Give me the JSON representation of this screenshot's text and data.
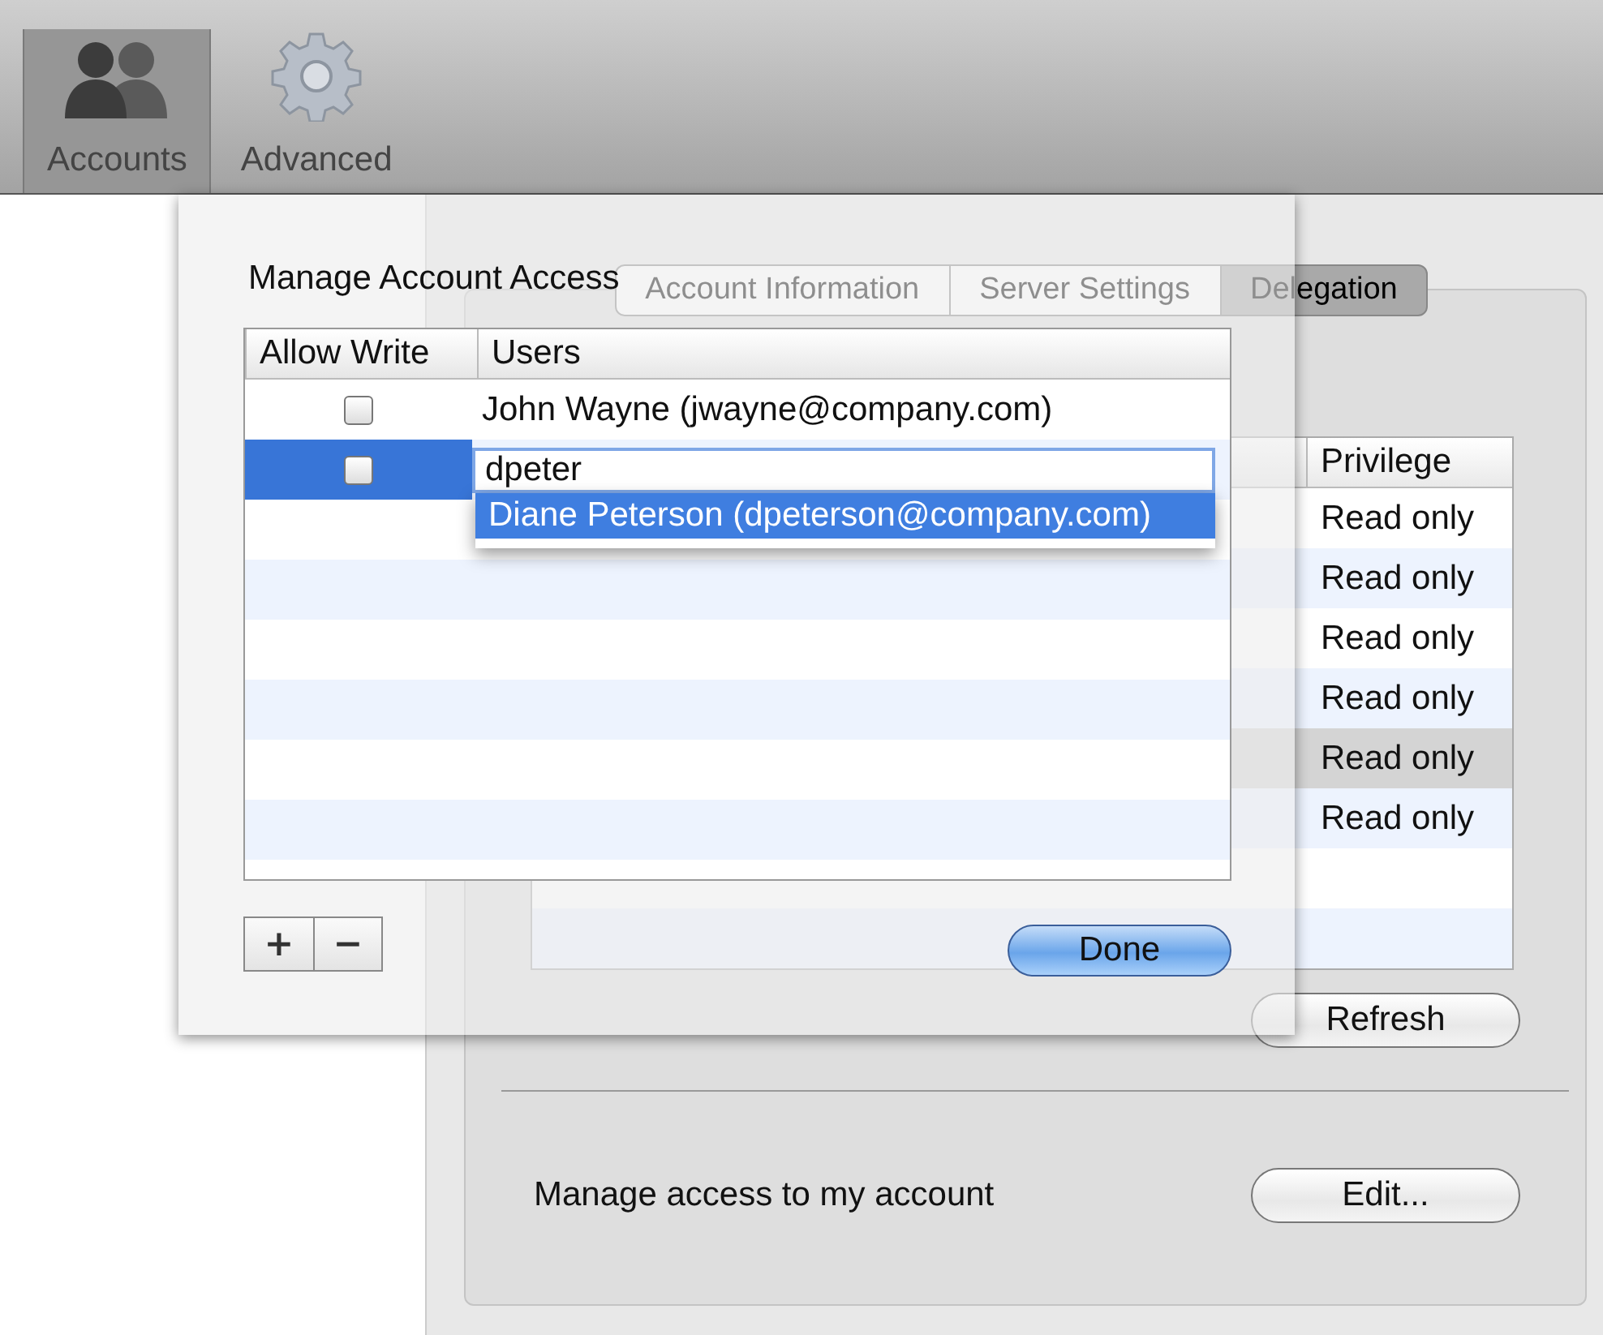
{
  "toolbar": {
    "items": [
      {
        "label": "Accounts",
        "kind": "people",
        "selected": true
      },
      {
        "label": "Advanced",
        "kind": "gear",
        "selected": false
      }
    ]
  },
  "tabs": [
    {
      "label": "Account Information",
      "selected": false
    },
    {
      "label": "Server Settings",
      "selected": false
    },
    {
      "label": "Delegation",
      "selected": true
    }
  ],
  "delegates_table": {
    "columns": [
      "Privilege"
    ],
    "rows": [
      {
        "privilege": "Read only",
        "selected": false
      },
      {
        "privilege": "Read only",
        "selected": false
      },
      {
        "privilege": "Read only",
        "selected": false
      },
      {
        "privilege": "Read only",
        "selected": false
      },
      {
        "privilege": "Read only",
        "selected": true
      },
      {
        "privilege": "Read only",
        "selected": false
      }
    ]
  },
  "refresh_button": "Refresh",
  "access_label": "Manage access to my account",
  "edit_button": "Edit...",
  "sheet": {
    "title": "Manage Account Access",
    "columns": [
      "Allow Write",
      "Users"
    ],
    "rows": [
      {
        "kind": "text",
        "allow_write": false,
        "selected": false,
        "user": "John Wayne (jwayne@company.com)"
      },
      {
        "kind": "editing",
        "allow_write": false,
        "selected": true,
        "value": "dpeter",
        "suggestions": [
          {
            "label": "Diane Peterson (dpeterson@company.com)",
            "selected": true
          }
        ]
      }
    ],
    "add_button": "+",
    "remove_button": "−",
    "done_button": "Done"
  }
}
